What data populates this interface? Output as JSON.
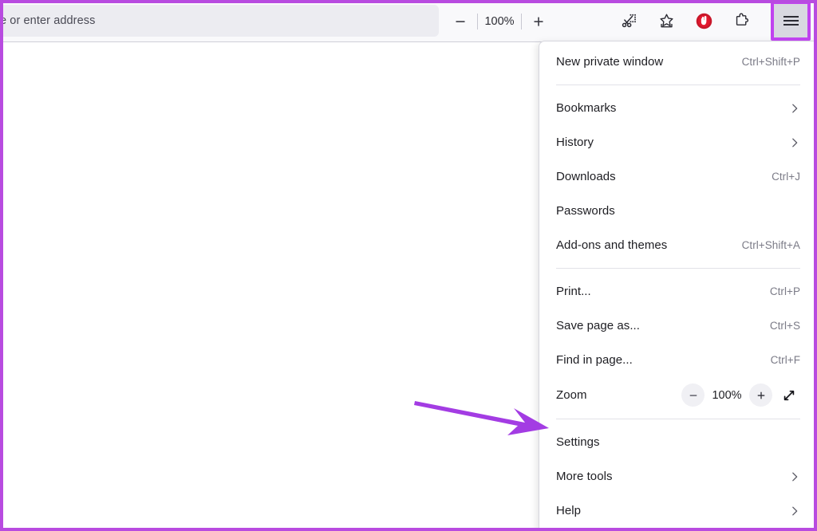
{
  "toolbar": {
    "address_bar": {
      "value": "",
      "placeholder_visible": "e or enter address"
    },
    "zoom_out_icon": "minus-icon",
    "zoom_level": "100%",
    "zoom_in_icon": "plus-icon",
    "icons": [
      {
        "name": "screenshot-scissors-icon",
        "label": "Take a screenshot"
      },
      {
        "name": "bookmark-star-icon",
        "label": "Bookmark this page"
      },
      {
        "name": "ublock-shield-icon",
        "label": "uBlock Origin"
      },
      {
        "name": "extensions-puzzle-icon",
        "label": "Extensions"
      }
    ],
    "app_menu_button": {
      "name": "hamburger-menu-button",
      "label": "Open application menu",
      "highlighted": true
    }
  },
  "annotation": {
    "arrow_color": "#a33ce3",
    "highlight_color": "#c043ef",
    "points_to": "Settings"
  },
  "menu": {
    "sections": [
      {
        "items": [
          {
            "label": "New private window",
            "shortcut": "Ctrl+Shift+P",
            "submenu": false
          }
        ]
      },
      {
        "items": [
          {
            "label": "Bookmarks",
            "shortcut": "",
            "submenu": true
          },
          {
            "label": "History",
            "shortcut": "",
            "submenu": true
          },
          {
            "label": "Downloads",
            "shortcut": "Ctrl+J",
            "submenu": false
          },
          {
            "label": "Passwords",
            "shortcut": "",
            "submenu": false
          },
          {
            "label": "Add-ons and themes",
            "shortcut": "Ctrl+Shift+A",
            "submenu": false
          }
        ]
      },
      {
        "items": [
          {
            "label": "Print...",
            "shortcut": "Ctrl+P",
            "submenu": false
          },
          {
            "label": "Save page as...",
            "shortcut": "Ctrl+S",
            "submenu": false
          },
          {
            "label": "Find in page...",
            "shortcut": "Ctrl+F",
            "submenu": false
          }
        ]
      }
    ],
    "zoom_row": {
      "label": "Zoom",
      "minus_icon": "minus-icon",
      "value": "100%",
      "plus_icon": "plus-icon",
      "fullscreen_icon": "fullscreen-expand-icon"
    },
    "footer_items": [
      {
        "label": "Settings",
        "shortcut": "",
        "submenu": false
      },
      {
        "label": "More tools",
        "shortcut": "",
        "submenu": true
      },
      {
        "label": "Help",
        "shortcut": "",
        "submenu": true
      }
    ]
  }
}
